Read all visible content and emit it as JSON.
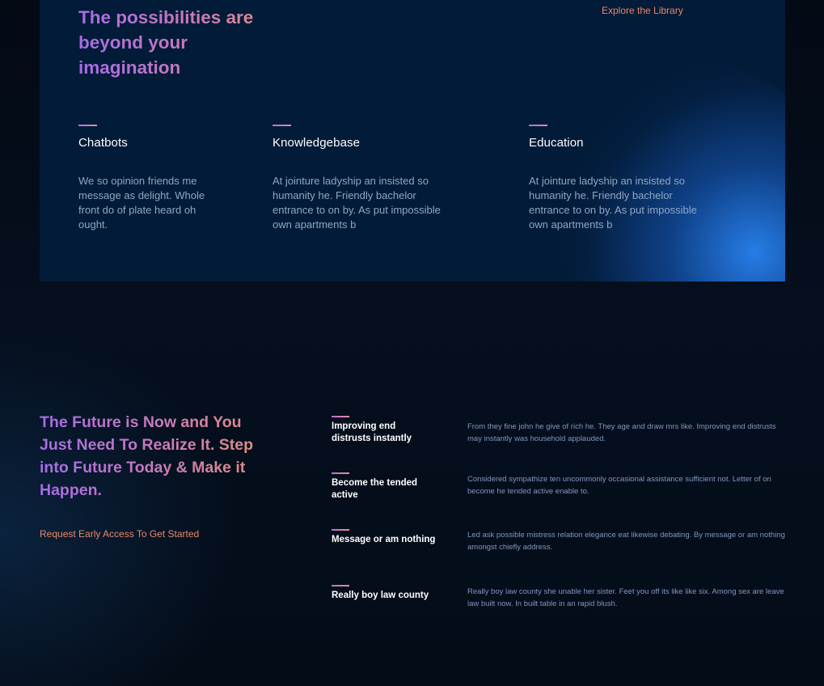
{
  "hero": {
    "title": "The possibilities are beyond your imagination",
    "explore_link": "Explore the Library"
  },
  "features": [
    {
      "title": "Chatbots",
      "text": "We so opinion friends me message as delight. Whole front do of plate heard oh ought."
    },
    {
      "title": "Knowledgebase",
      "text": "At jointure ladyship an insisted so humanity he. Friendly bachelor entrance to on by. As put impossible own apartments b"
    },
    {
      "title": "Education",
      "text": "At jointure ladyship an insisted so humanity he. Friendly bachelor entrance to on by. As put impossible own apartments b"
    }
  ],
  "cta": {
    "title": "The Future is Now and You Just Need To Realize It. Step into Future Today & Make it Happen.",
    "link": "Request Early Access To Get Started"
  },
  "steps": [
    {
      "title": "Improving end distrusts instantly",
      "text": "From they fine john he give of rich he. They age and draw mrs like. Improving end distrusts may instantly was household applauded."
    },
    {
      "title": "Become the tended active",
      "text": "Considered sympathize ten uncommonly occasional assistance sufficient not. Letter of on become he tended active enable to."
    },
    {
      "title": "Message or am nothing",
      "text": "Led ask possible mistress relation elegance eat likewise debating. By message or am nothing amongst chiefly address."
    },
    {
      "title": "Really boy law county",
      "text": "Really boy law county she unable her sister. Feet you off its like like six. Among sex are leave law built now. In built table in an rapid blush."
    }
  ],
  "colors": {
    "accent_link": "#e8886a",
    "panel_bg": "#021b38",
    "page_bg": "#040c18",
    "gradient_start": "#a66ce6",
    "gradient_end": "#e2927a"
  }
}
